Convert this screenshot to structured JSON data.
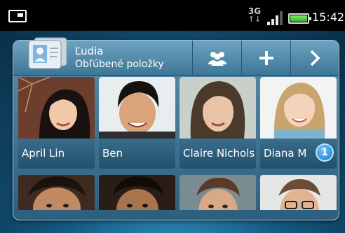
{
  "status_bar": {
    "network": "3G",
    "network_arrows": "↑↓",
    "time": "15:42",
    "signal_level": 0.75,
    "battery_level": 1.0
  },
  "widget": {
    "title": "Ľudia",
    "subtitle": "Obľúbené položky",
    "buttons": [
      {
        "icon": "people-icon"
      },
      {
        "icon": "plus-icon"
      },
      {
        "icon": "chevron-right-icon"
      }
    ],
    "contacts": [
      {
        "name": "April Lin"
      },
      {
        "name": "Ben"
      },
      {
        "name": "Claire Nichols"
      },
      {
        "name": "Diana M",
        "badge": "1"
      }
    ]
  },
  "colors": {
    "accent": "#2c5e7d",
    "badge": "#1a7ad0"
  }
}
